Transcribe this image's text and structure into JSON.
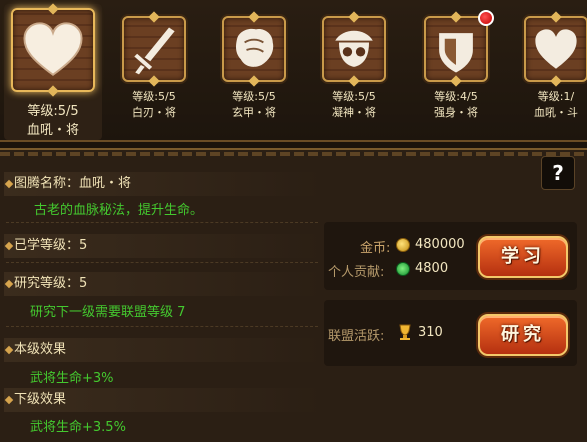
{
  "tiles": [
    {
      "level": "等级:5/5",
      "name": "血吼・将",
      "icon": "heart-icon"
    },
    {
      "level": "等级:5/5",
      "name": "白刃・将",
      "icon": "sword-icon"
    },
    {
      "level": "等级:5/5",
      "name": "玄甲・将",
      "icon": "armor-icon"
    },
    {
      "level": "等级:5/5",
      "name": "凝神・将",
      "icon": "skull-icon"
    },
    {
      "level": "等级:4/5",
      "name": "强身・将",
      "icon": "shield-icon"
    },
    {
      "level": "等级:1/",
      "name": "血吼・斗",
      "icon": "heart-icon"
    }
  ],
  "detail": {
    "totem_label": "图腾名称：",
    "totem_name": "血吼・将",
    "totem_desc": "古老的血脉秘法，提升生命。",
    "learned_label": "已学等级：",
    "learned_value": "5",
    "research_label": "研究等级：",
    "research_value": "5",
    "research_req": "研究下一级需要联盟等级  7",
    "current_label": "本级效果",
    "current_effect": "武将生命+3%",
    "next_label": "下级效果",
    "next_effect": "武将生命+3.5%"
  },
  "learn": {
    "gold_label": "金币:",
    "gold_value": "480000",
    "contrib_label": "个人贡献:",
    "contrib_value": "4800",
    "button": "学习"
  },
  "research": {
    "activity_label": "联盟活跃:",
    "activity_value": "310",
    "button": "研究"
  },
  "help": "?"
}
